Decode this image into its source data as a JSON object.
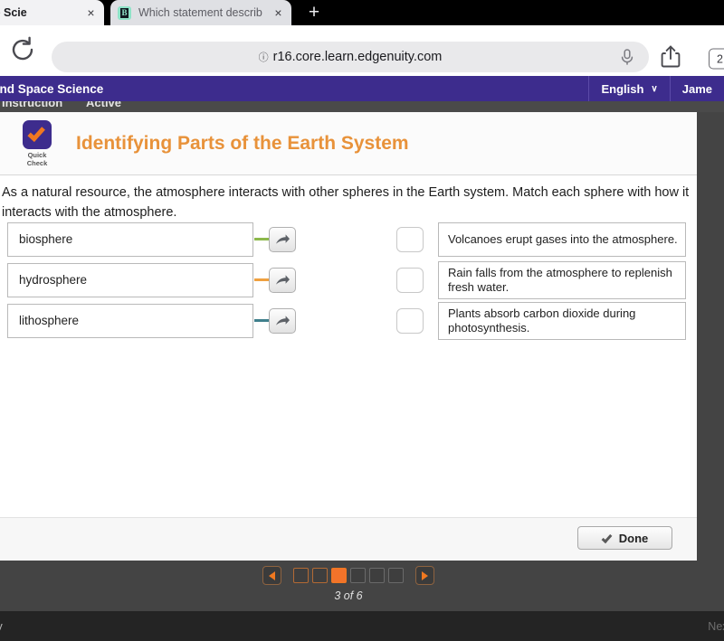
{
  "browser": {
    "tabs": [
      {
        "title": "and Space Scie",
        "favicon": "",
        "close": "×"
      },
      {
        "title": "Which statement describ",
        "favicon": "B",
        "close": "×"
      }
    ],
    "new_tab_label": "+",
    "reload_icon": "reload-icon",
    "url": "r16.core.learn.edgenuity.com",
    "lock_icon": "ⓘ",
    "mic_icon": "microphone-icon",
    "share_icon": "share-icon",
    "tab_count": "2"
  },
  "app_header": {
    "course": "and Space Science",
    "language": "English",
    "language_caret": "∨",
    "user": "Jame"
  },
  "subbar": {
    "instruction": "Instruction",
    "status": "Active"
  },
  "lesson": {
    "badge_line1": "Quick",
    "badge_line2": "Check",
    "title": "Identifying Parts of the Earth System",
    "prompt": "As a natural resource, the atmosphere interacts with other spheres in the Earth system. Match each sphere with how it interacts with the atmosphere."
  },
  "matching": {
    "terms": [
      {
        "label": "biosphere",
        "connector_color": "#8cb84b"
      },
      {
        "label": "hydrosphere",
        "connector_color": "#efa040"
      },
      {
        "label": "lithosphere",
        "connector_color": "#3f7f8c"
      }
    ],
    "statements": [
      {
        "text": "Volcanoes erupt gases into the atmosphere."
      },
      {
        "text": "Rain falls from the atmosphere to replenish fresh water."
      },
      {
        "text": "Plants absorb carbon dioxide during photosynthesis."
      }
    ]
  },
  "actions": {
    "done_label": "Done"
  },
  "pager": {
    "prev_label": "◀",
    "next_label": "▶",
    "dots": [
      "visited",
      "visited",
      "current",
      "future",
      "future",
      "future"
    ],
    "position_label": "3 of 6"
  },
  "footer": {
    "left": "vity",
    "right": "Next"
  },
  "colors": {
    "brand_purple": "#3d2c8d",
    "accent_orange": "#e8923a",
    "stage_gray": "#444444"
  }
}
